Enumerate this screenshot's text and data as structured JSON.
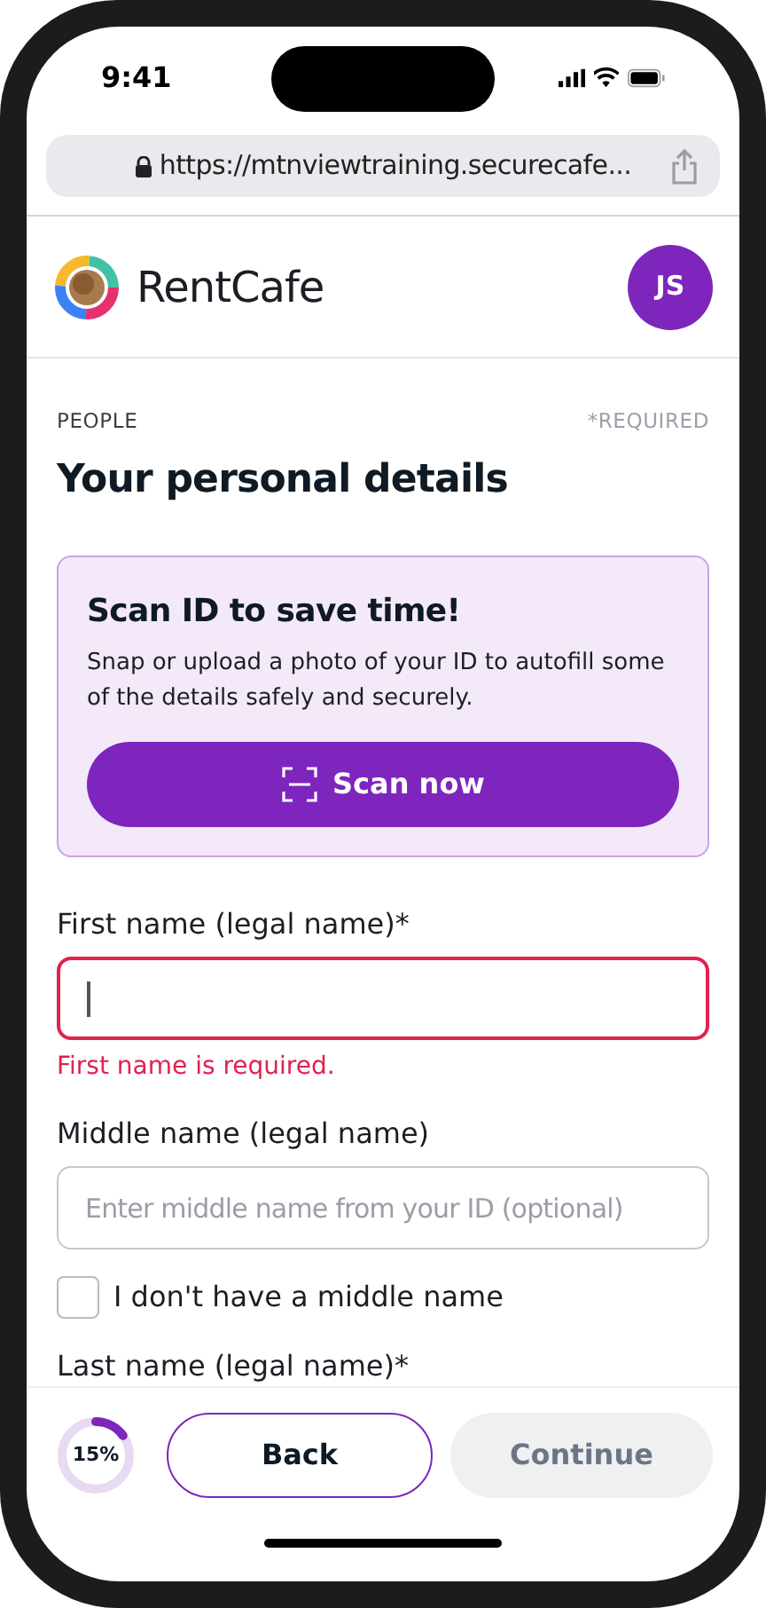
{
  "status_bar": {
    "time": "9:41"
  },
  "browser": {
    "url": "https://mtnviewtraining.securecafe..."
  },
  "header": {
    "logo_text": "RentCafe",
    "avatar": "JS"
  },
  "section": {
    "label": "PEOPLE",
    "required_note": "*REQUIRED",
    "title": "Your personal details"
  },
  "scan_card": {
    "title": "Scan ID to save time!",
    "body": "Snap or upload a photo of your ID to autofill some of the details safely and securely.",
    "button": "Scan now"
  },
  "fields": [
    {
      "kind": "input",
      "label": "First name (legal name)*",
      "focused": true,
      "invalid": true,
      "error": "First name is required."
    },
    {
      "kind": "input",
      "label": "Middle name (legal name)",
      "placeholder": "Enter middle name from your ID (optional)",
      "focused": false,
      "invalid": false
    },
    {
      "kind": "checkbox",
      "label": "I don't have a middle name",
      "checked": false
    },
    {
      "kind": "heading",
      "label": "Last name (legal name)*"
    }
  ],
  "footer": {
    "progress": {
      "level": 0.15,
      "text": "15%"
    },
    "back": "Back",
    "continue": {
      "label": "Continue",
      "disabled": true
    }
  }
}
